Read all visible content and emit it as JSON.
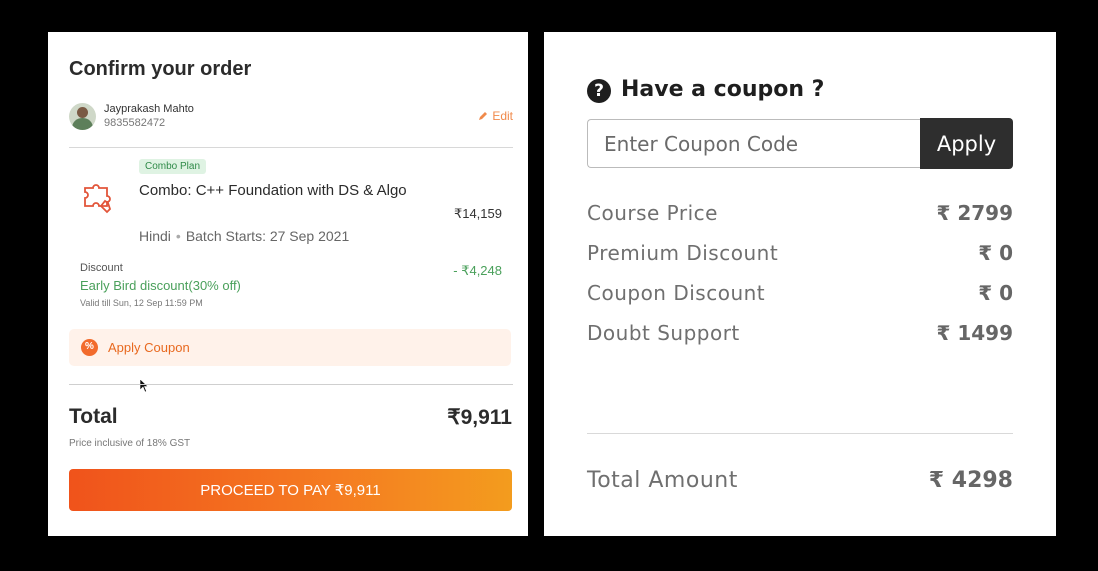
{
  "order": {
    "title": "Confirm your order",
    "user": {
      "name": "Jayprakash Mahto",
      "phone": "9835582472",
      "edit_label": "Edit"
    },
    "product": {
      "badge": "Combo Plan",
      "name": "Combo: C++ Foundation with DS & Algo",
      "price": "₹14,159",
      "language": "Hindi",
      "batch": "Batch Starts: 27 Sep 2021",
      "icon": "puzzle-icon"
    },
    "discount": {
      "label": "Discount",
      "name": "Early Bird discount(30% off)",
      "valid": "Valid till Sun, 12 Sep 11:59 PM",
      "amount": "- ₹4,248"
    },
    "coupon": {
      "label": "Apply Coupon",
      "icon": "percent-badge-icon"
    },
    "total_label": "Total",
    "total_amount": "₹9,911",
    "gst_note": "Price inclusive of 18% GST",
    "pay_button": "PROCEED TO PAY ₹9,911",
    "colors": {
      "accent": "#f26b2c",
      "discount": "#4aa05b"
    }
  },
  "coupon_panel": {
    "title": "Have a coupon ?",
    "icon": "question-circle-icon",
    "input_placeholder": "Enter Coupon Code",
    "apply_label": "Apply",
    "rows": [
      {
        "label": "Course Price",
        "value": "₹ 2799"
      },
      {
        "label": "Premium Discount",
        "value": "₹ 0"
      },
      {
        "label": "Coupon Discount",
        "value": "₹ 0"
      },
      {
        "label": "Doubt Support",
        "value": "₹ 1499"
      }
    ],
    "total_label": "Total Amount",
    "total_value": "₹ 4298"
  }
}
